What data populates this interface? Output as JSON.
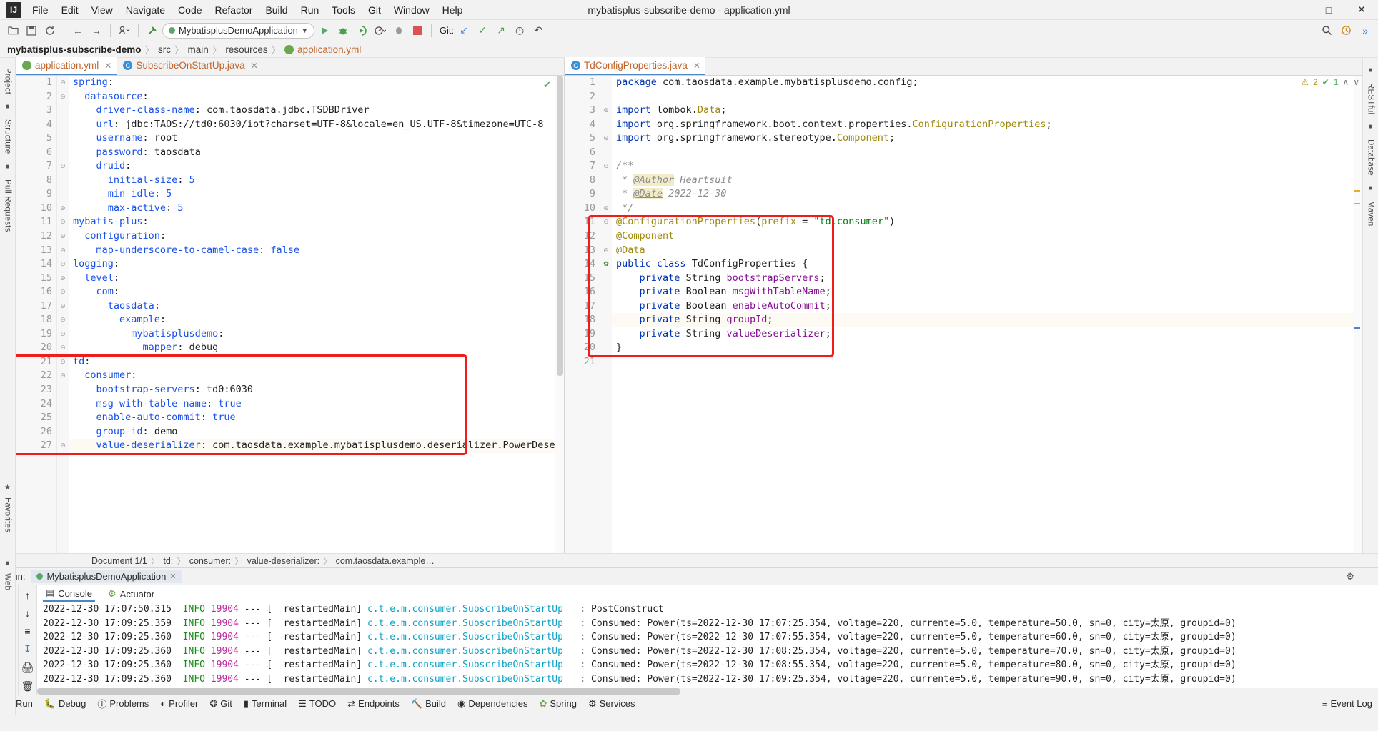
{
  "window": {
    "title": "mybatisplus-subscribe-demo - application.yml",
    "logo_text": "IJ",
    "minimize": "–",
    "maximize": "□",
    "close": "✕"
  },
  "menu": [
    "File",
    "Edit",
    "View",
    "Navigate",
    "Code",
    "Refactor",
    "Build",
    "Run",
    "Tools",
    "Git",
    "Window",
    "Help"
  ],
  "toolbar": {
    "open_icon": "folder-open-icon",
    "save_icon": "save-icon",
    "sync_icon": "sync-icon",
    "back_icon": "←",
    "forward_icon": "→",
    "profile_icon": "☲",
    "build_icon": "✕",
    "run_config": "MybatisplusDemoApplication",
    "run_icon": "▶",
    "debug_icon": "🐞",
    "coverage_icon": "◑",
    "profiler_icon": "◔",
    "attach_icon": "●",
    "stop_icon": "■",
    "git_label": "Git:",
    "git_update": "↙",
    "git_commit": "✓",
    "git_push": "↗",
    "git_history": "↺",
    "git_clock": "◴",
    "git_rollback": "↶",
    "search_icon": "🔍",
    "plugin_icon": "⚙",
    "expand_icon": "»"
  },
  "breadcrumb": {
    "root": "mybatisplus-subscribe-demo",
    "parts": [
      "src",
      "main",
      "resources"
    ],
    "file": "application.yml",
    "separator": "〉"
  },
  "left_strip": [
    "Project",
    "Structure",
    "Pull Requests"
  ],
  "right_strip": [
    "RESTful",
    "Database",
    "Maven"
  ],
  "editor_left": {
    "tabs": [
      {
        "label": "application.yml",
        "icon": "yaml-file-icon",
        "active": true
      },
      {
        "label": "SubscribeOnStartUp.java",
        "icon": "java-class-icon",
        "active": false
      }
    ],
    "lines": [
      {
        "n": 1,
        "indent": 0,
        "key": "spring",
        "value": "",
        "fold": "minus-top"
      },
      {
        "n": 2,
        "indent": 1,
        "key": "datasource",
        "value": "",
        "fold": "minus"
      },
      {
        "n": 3,
        "indent": 2,
        "key": "driver-class-name",
        "value": "com.taosdata.jdbc.TSDBDriver"
      },
      {
        "n": 4,
        "indent": 2,
        "key": "url",
        "value": "jdbc:TAOS://td0:6030/iot?charset=UTF-8&locale=en_US.UTF-8&timezone=UTC-8"
      },
      {
        "n": 5,
        "indent": 2,
        "key": "username",
        "value": "root"
      },
      {
        "n": 6,
        "indent": 2,
        "key": "password",
        "value": "taosdata"
      },
      {
        "n": 7,
        "indent": 2,
        "key": "druid",
        "value": "",
        "fold": "minus"
      },
      {
        "n": 8,
        "indent": 3,
        "key": "initial-size",
        "value": "5",
        "num": true
      },
      {
        "n": 9,
        "indent": 3,
        "key": "min-idle",
        "value": "5",
        "num": true
      },
      {
        "n": 10,
        "indent": 3,
        "key": "max-active",
        "value": "5",
        "num": true,
        "fold": "minus-end"
      },
      {
        "n": 11,
        "indent": 0,
        "key": "mybatis-plus",
        "value": "",
        "fold": "minus-top"
      },
      {
        "n": 12,
        "indent": 1,
        "key": "configuration",
        "value": "",
        "fold": "minus"
      },
      {
        "n": 13,
        "indent": 2,
        "key": "map-underscore-to-camel-case",
        "value": "false",
        "num": true,
        "fold": "minus-end"
      },
      {
        "n": 14,
        "indent": 0,
        "key": "logging",
        "value": "",
        "fold": "minus-top"
      },
      {
        "n": 15,
        "indent": 1,
        "key": "level",
        "value": "",
        "fold": "minus"
      },
      {
        "n": 16,
        "indent": 2,
        "key": "com",
        "value": "",
        "fold": "minus"
      },
      {
        "n": 17,
        "indent": 3,
        "key": "taosdata",
        "value": "",
        "fold": "minus"
      },
      {
        "n": 18,
        "indent": 4,
        "key": "example",
        "value": "",
        "fold": "minus"
      },
      {
        "n": 19,
        "indent": 5,
        "key": "mybatisplusdemo",
        "value": "",
        "fold": "minus"
      },
      {
        "n": 20,
        "indent": 6,
        "key": "mapper",
        "value": "debug",
        "fold": "minus-end"
      },
      {
        "n": 21,
        "indent": 0,
        "key": "td",
        "value": "",
        "fold": "minus-top"
      },
      {
        "n": 22,
        "indent": 1,
        "key": "consumer",
        "value": "",
        "fold": "minus"
      },
      {
        "n": 23,
        "indent": 2,
        "key": "bootstrap-servers",
        "value": "td0:6030"
      },
      {
        "n": 24,
        "indent": 2,
        "key": "msg-with-table-name",
        "value": "true",
        "num": true
      },
      {
        "n": 25,
        "indent": 2,
        "key": "enable-auto-commit",
        "value": "true",
        "num": true
      },
      {
        "n": 26,
        "indent": 2,
        "key": "group-id",
        "value": "demo"
      },
      {
        "n": 27,
        "indent": 2,
        "key": "value-deserializer",
        "value": "com.taosdata.example.mybatisplusdemo.deserializer.PowerDeserializer",
        "highlight": true,
        "fold": "minus-end"
      }
    ],
    "redbox_label": "yaml-td-consumer-highlight"
  },
  "editor_right": {
    "tab": {
      "label": "TdConfigProperties.java",
      "icon": "java-class-icon"
    },
    "inspection": {
      "warnings": "2",
      "checks": "1",
      "warn_icon": "⚠",
      "ok_icon": "✔",
      "up": "∧",
      "down": "∨"
    },
    "check_ok": "✔",
    "lines": [
      {
        "n": 1,
        "type": "code",
        "text": "package com.taosdata.example.mybatisplusdemo.config;",
        "kw": "package"
      },
      {
        "n": 2,
        "type": "blank",
        "text": ""
      },
      {
        "n": 3,
        "type": "import",
        "text": "import lombok.Data;",
        "kw": "import",
        "cls": "Data",
        "fold": "minus-top"
      },
      {
        "n": 4,
        "type": "import",
        "text": "import org.springframework.boot.context.properties.ConfigurationProperties;",
        "kw": "import",
        "cls": "ConfigurationProperties"
      },
      {
        "n": 5,
        "type": "import",
        "text": "import org.springframework.stereotype.Component;",
        "kw": "import",
        "cls": "Component",
        "fold": "minus-end"
      },
      {
        "n": 6,
        "type": "blank",
        "text": ""
      },
      {
        "n": 7,
        "type": "comment",
        "text": "/**",
        "fold": "minus-top"
      },
      {
        "n": 8,
        "type": "comment-tag",
        "text": " * @Author Heartsuit",
        "tag": "@Author",
        "rest": "Heartsuit"
      },
      {
        "n": 9,
        "type": "comment-tag",
        "text": " * @Date 2022-12-30",
        "tag": "@Date",
        "rest": "2022-12-30"
      },
      {
        "n": 10,
        "type": "comment",
        "text": " */",
        "fold": "minus-end"
      },
      {
        "n": 11,
        "type": "anno",
        "text": "@ConfigurationProperties(prefix = \"td.consumer\")",
        "fold": "minus-top"
      },
      {
        "n": 12,
        "type": "anno",
        "text": "@Component"
      },
      {
        "n": 13,
        "type": "anno",
        "text": "@Data",
        "fold": "minus-end"
      },
      {
        "n": 14,
        "type": "classdecl",
        "text": "public class TdConfigProperties {",
        "gutter_icon": "bean-icon"
      },
      {
        "n": 15,
        "type": "field",
        "text": "    private String bootstrapServers;",
        "mods": "private String",
        "name": "bootstrapServers"
      },
      {
        "n": 16,
        "type": "field",
        "text": "    private Boolean msgWithTableName;",
        "mods": "private Boolean",
        "name": "msgWithTableName"
      },
      {
        "n": 17,
        "type": "field",
        "text": "    private Boolean enableAutoCommit;",
        "mods": "private Boolean",
        "name": "enableAutoCommit"
      },
      {
        "n": 18,
        "type": "field",
        "text": "    private String groupId;",
        "mods": "private String",
        "name": "groupId",
        "highlight": true
      },
      {
        "n": 19,
        "type": "field",
        "text": "    private String valueDeserializer;",
        "mods": "private String",
        "name": "valueDeserializer"
      },
      {
        "n": 20,
        "type": "code",
        "text": "}"
      },
      {
        "n": 21,
        "type": "blank",
        "text": ""
      }
    ],
    "redbox_label": "java-config-properties-highlight"
  },
  "doc_status": {
    "document": "Document 1/1",
    "path": [
      "td:",
      "consumer:",
      "value-deserializer:",
      "com.taosdata.example…"
    ],
    "separator": "〉"
  },
  "run_panel": {
    "label": "Run:",
    "config_name": "MybatisplusDemoApplication",
    "close_icon": "✕",
    "settings_icon": "⚙",
    "minimize_icon": "—",
    "tabs": [
      {
        "label": "Console",
        "icon": "console-icon",
        "active": true
      },
      {
        "label": "Actuator",
        "icon": "actuator-icon",
        "active": false
      }
    ],
    "side_icons": [
      "rerun-icon",
      "stop-icon",
      "up-icon",
      "down-icon",
      "wrench-icon",
      "print-icon",
      "soft-wrap-icon",
      "scroll-end-icon",
      "trash-icon",
      "camera-icon",
      "thread-icon"
    ],
    "logs": [
      {
        "time": "2022-12-30 17:07:50.315",
        "level": "INFO",
        "pid": "19904",
        "dashes": "---",
        "thread": "[  restartedMain]",
        "logger": "c.t.e.m.consumer.SubscribeOnStartUp",
        "msg": ": PostConstruct"
      },
      {
        "time": "2022-12-30 17:09:25.359",
        "level": "INFO",
        "pid": "19904",
        "dashes": "---",
        "thread": "[  restartedMain]",
        "logger": "c.t.e.m.consumer.SubscribeOnStartUp",
        "msg": ": Consumed: Power(ts=2022-12-30 17:07:25.354, voltage=220, currente=5.0, temperature=50.0, sn=0, city=太原, groupid=0)"
      },
      {
        "time": "2022-12-30 17:09:25.360",
        "level": "INFO",
        "pid": "19904",
        "dashes": "---",
        "thread": "[  restartedMain]",
        "logger": "c.t.e.m.consumer.SubscribeOnStartUp",
        "msg": ": Consumed: Power(ts=2022-12-30 17:07:55.354, voltage=220, currente=5.0, temperature=60.0, sn=0, city=太原, groupid=0)"
      },
      {
        "time": "2022-12-30 17:09:25.360",
        "level": "INFO",
        "pid": "19904",
        "dashes": "---",
        "thread": "[  restartedMain]",
        "logger": "c.t.e.m.consumer.SubscribeOnStartUp",
        "msg": ": Consumed: Power(ts=2022-12-30 17:08:25.354, voltage=220, currente=5.0, temperature=70.0, sn=0, city=太原, groupid=0)"
      },
      {
        "time": "2022-12-30 17:09:25.360",
        "level": "INFO",
        "pid": "19904",
        "dashes": "---",
        "thread": "[  restartedMain]",
        "logger": "c.t.e.m.consumer.SubscribeOnStartUp",
        "msg": ": Consumed: Power(ts=2022-12-30 17:08:55.354, voltage=220, currente=5.0, temperature=80.0, sn=0, city=太原, groupid=0)"
      },
      {
        "time": "2022-12-30 17:09:25.360",
        "level": "INFO",
        "pid": "19904",
        "dashes": "---",
        "thread": "[  restartedMain]",
        "logger": "c.t.e.m.consumer.SubscribeOnStartUp",
        "msg": ": Consumed: Power(ts=2022-12-30 17:09:25.354, voltage=220, currente=5.0, temperature=90.0, sn=0, city=太原, groupid=0)"
      }
    ]
  },
  "statusbar": {
    "items": [
      {
        "label": "Run",
        "icon": "run-icon"
      },
      {
        "label": "Debug",
        "icon": "debug-icon"
      },
      {
        "label": "Problems",
        "icon": "problems-icon"
      },
      {
        "label": "Profiler",
        "icon": "profiler-icon"
      },
      {
        "label": "Git",
        "icon": "git-icon"
      },
      {
        "label": "Terminal",
        "icon": "terminal-icon"
      },
      {
        "label": "TODO",
        "icon": "todo-icon"
      },
      {
        "label": "Endpoints",
        "icon": "endpoints-icon"
      },
      {
        "label": "Build",
        "icon": "build-icon"
      },
      {
        "label": "Dependencies",
        "icon": "dependencies-icon"
      },
      {
        "label": "Spring",
        "icon": "spring-icon"
      },
      {
        "label": "Services",
        "icon": "services-icon"
      }
    ],
    "event_log": "Event Log",
    "event_log_icon": "≡"
  },
  "favorites_strip": [
    "Favorites",
    "Web"
  ],
  "colors": {
    "accent": "#4a86c8",
    "redbox": "#f01b1b",
    "green": "#59a869",
    "yaml_key": "#1750eb",
    "java_keyword": "#0033b3",
    "annotation": "#9e880d",
    "string": "#067d17",
    "field": "#871094",
    "logger": "#0aa3c7"
  }
}
